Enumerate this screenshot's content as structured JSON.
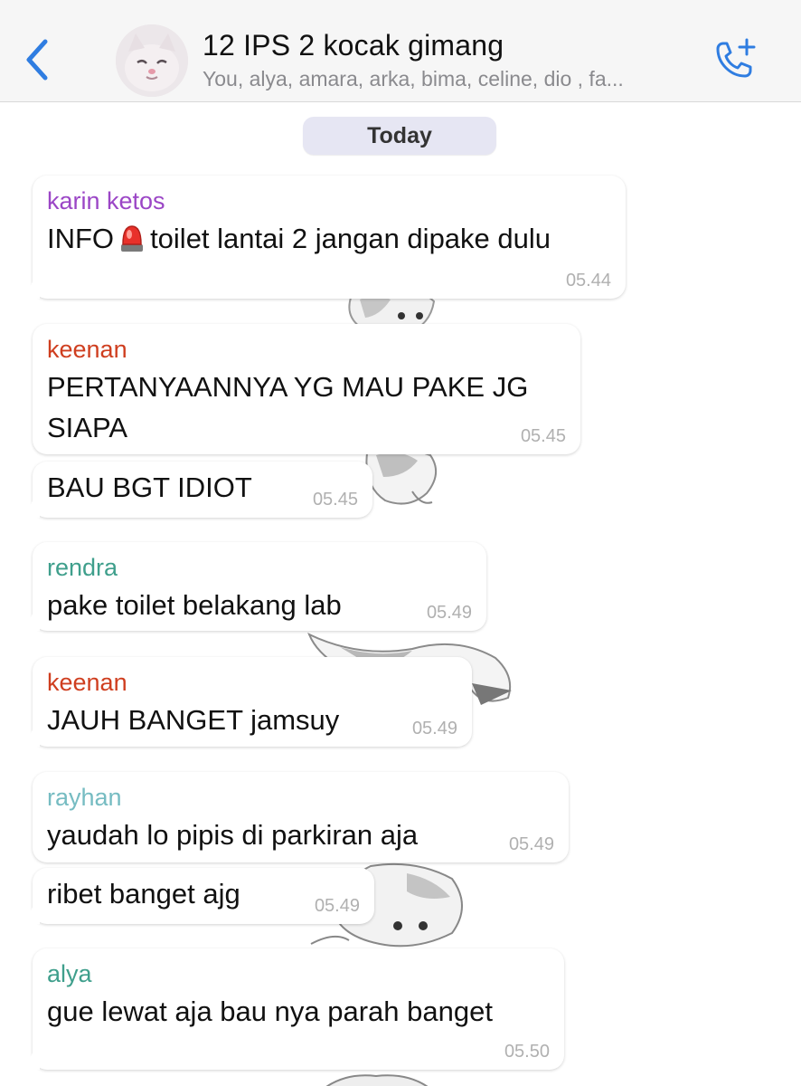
{
  "header": {
    "title": "12 IPS 2 kocak gimang",
    "members": "You, alya, amara, arka, bima, celine, dio , fa...",
    "accent_color": "#2f7de1",
    "back_icon": "chevron-left-icon",
    "call_icon": "phone-plus-icon"
  },
  "date_separator": "Today",
  "colors": {
    "karin": "#9b46c6",
    "keenan": "#cf3e1f",
    "rendra": "#3f9f8c",
    "rayhan": "#76bcc2",
    "alya": "#3f9f8c"
  },
  "messages": [
    {
      "sender": "karin ketos",
      "text_before": "INFO",
      "emoji_icon": "police-light-icon",
      "text_after": "toilet lantai 2 jangan dipake dulu",
      "time": "05.44"
    },
    {
      "sender": "keenan",
      "text": "PERTANYAANNYA YG MAU PAKE JG SIAPA",
      "time": "05.45"
    },
    {
      "text": "BAU BGT IDIOT",
      "time": "05.45"
    },
    {
      "sender": "rendra",
      "text": "pake toilet belakang lab",
      "time": "05.49"
    },
    {
      "sender": "keenan",
      "text": "JAUH BANGET jamsuy",
      "time": "05.49"
    },
    {
      "sender": "rayhan",
      "text": "yaudah lo pipis di parkiran aja",
      "time": "05.49"
    },
    {
      "text": "ribet banget ajg",
      "time": "05.49"
    },
    {
      "sender": "alya",
      "text": "gue lewat aja bau nya parah banget",
      "time": "05.50"
    }
  ]
}
